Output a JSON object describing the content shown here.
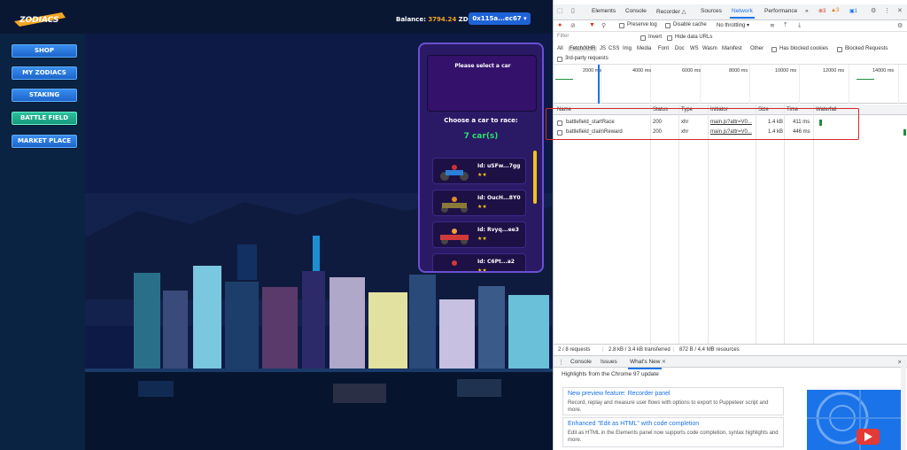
{
  "game": {
    "logo_text": "ZODIACS",
    "balance_label": "Balance:",
    "balance_amount": "3794.24",
    "balance_unit": "ZDC",
    "wallet": "0x115a...ec67",
    "nav": [
      "SHOP",
      "MY ZODIACS",
      "STAKING",
      "BATTLE FIELD",
      "MARKET PLACE"
    ],
    "active_nav": "BATTLE FIELD",
    "panel": {
      "preview_text": "Please select a car",
      "choose_text": "Choose a car to race:",
      "car_count": "7 car(s)",
      "cars": [
        {
          "id": "Id: uSFw...7gg",
          "stars": "★★"
        },
        {
          "id": "Id: OucH...8Y0",
          "stars": "★★"
        },
        {
          "id": "Id: Rvyq...ee3",
          "stars": "★★"
        },
        {
          "id": "Id: C6Pt...a2",
          "stars": "★★"
        }
      ]
    },
    "colors": {
      "accent": "#1e63d6",
      "active_nav": "#17967a",
      "panel": "#2a1a66",
      "count": "#2de06a",
      "stars": "#f2c318"
    }
  },
  "devtools": {
    "tabs": [
      "Elements",
      "Console",
      "Recorder △",
      "Sources",
      "Network",
      "Performance",
      "»"
    ],
    "selected_tab": "Network",
    "badges": {
      "errors": "3",
      "warnings": "3",
      "info": "1"
    },
    "toolbar": {
      "preserve_log": "Preserve log",
      "disable_cache": "Disable cache",
      "throttling": "No throttling"
    },
    "filter": {
      "placeholder": "Filter",
      "invert": "Invert",
      "hide_data_urls": "Hide data URLs",
      "types": [
        "All",
        "Fetch/XHR",
        "JS",
        "CSS",
        "Img",
        "Media",
        "Font",
        "Doc",
        "WS",
        "Wasm",
        "Manifest",
        "Other"
      ],
      "selected_type": "Fetch/XHR",
      "blocked_cookies": "Has blocked cookies",
      "blocked_requests": "Blocked Requests",
      "third_party": "3rd-party requests"
    },
    "timeline_ticks": [
      "2000 ms",
      "4000 ms",
      "6000 ms",
      "8000 ms",
      "10000 ms",
      "12000 ms",
      "14000 ms"
    ],
    "columns": [
      "Name",
      "Status",
      "Type",
      "Initiator",
      "Size",
      "Time",
      "Waterfall"
    ],
    "requests": [
      {
        "name": "battlefield_startRace",
        "status": "200",
        "type": "xhr",
        "initiator": "main.js?attr=V0...",
        "size": "1.4 kB",
        "time": "411 ms"
      },
      {
        "name": "battlefield_claimReward",
        "status": "200",
        "type": "xhr",
        "initiator": "main.js?attr=V0...",
        "size": "1.4 kB",
        "time": "446 ms"
      }
    ],
    "summary": {
      "requests": "2 / 8 requests",
      "transferred": "2.8 kB / 3.4 kB transferred",
      "resources": "872 B / 4.4 MB resources"
    },
    "drawer_tabs": [
      "Console",
      "Issues",
      "What's New"
    ],
    "drawer_selected": "What's New",
    "whatsnew": {
      "title": "Highlights from the Chrome 97 update",
      "cards": [
        {
          "title": "New preview feature: Recorder panel",
          "desc": "Record, replay and measure user flows with options to export to Puppeteer script and more."
        },
        {
          "title": "Enhanced \"Edit as HTML\" with code completion",
          "desc": "Edit as HTML in the Elements panel now supports code completion, syntax highlights and more."
        }
      ]
    }
  }
}
